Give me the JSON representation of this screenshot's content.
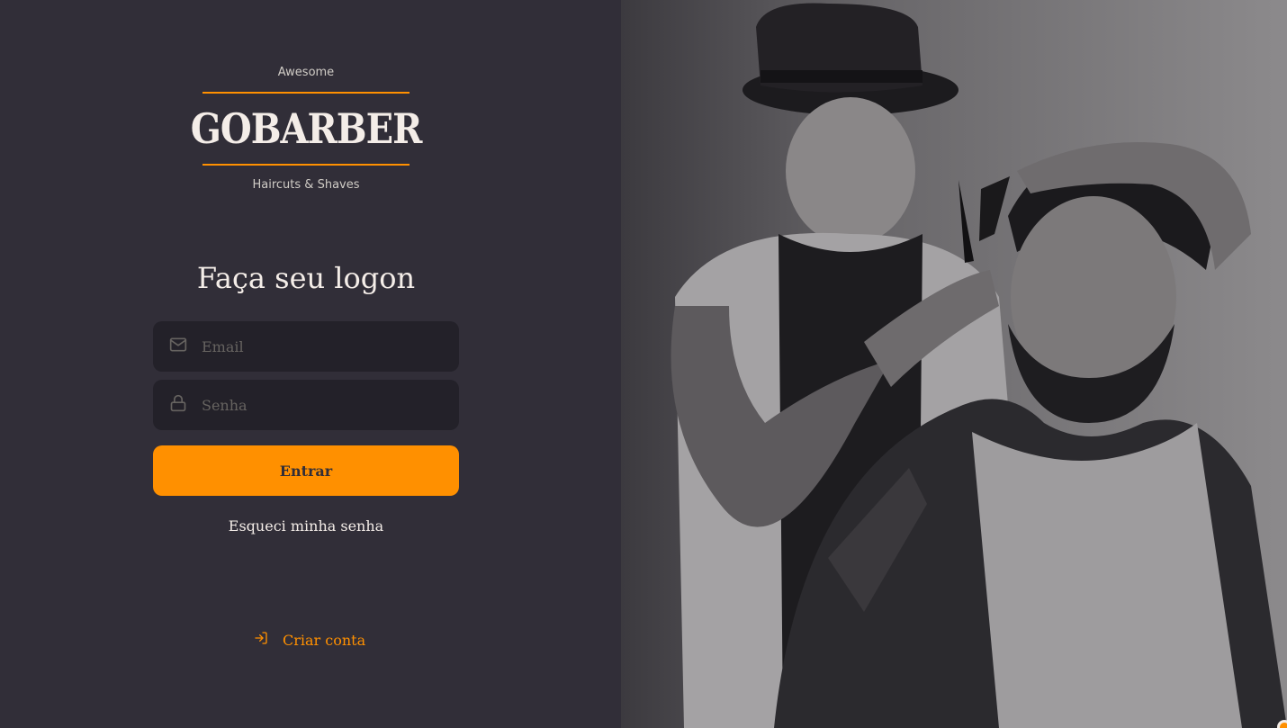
{
  "logo": {
    "tagline_top": "Awesome",
    "brand": "GOBARBER",
    "tagline_bottom": "Haircuts & Shaves"
  },
  "form": {
    "title": "Faça seu logon",
    "email_placeholder": "Email",
    "password_placeholder": "Senha",
    "submit_label": "Entrar",
    "forgot_label": "Esqueci minha senha"
  },
  "footer": {
    "create_account_label": "Criar conta"
  },
  "icons": {
    "email": "mail-icon",
    "password": "lock-icon",
    "create": "log-in-icon"
  },
  "colors": {
    "background": "#312e38",
    "input_background": "#232129",
    "accent": "#ff9000",
    "text": "#f4ede8",
    "placeholder": "#666360"
  }
}
